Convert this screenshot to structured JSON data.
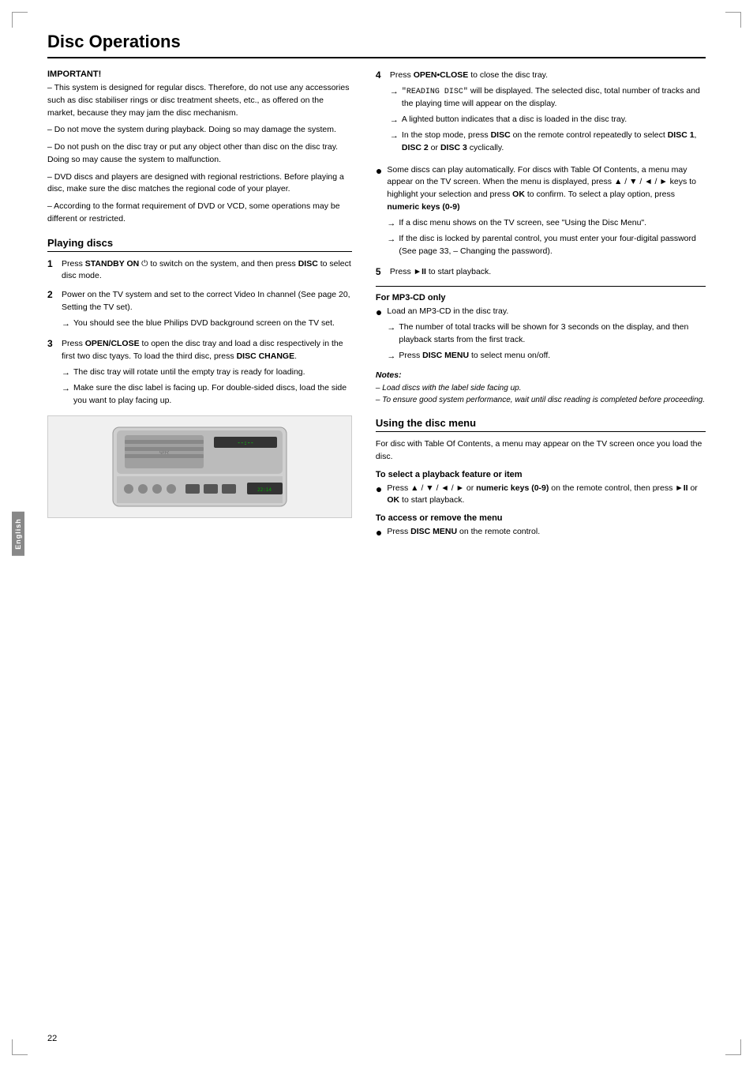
{
  "page": {
    "title": "Disc Operations",
    "page_number": "22",
    "side_tab": "English"
  },
  "important": {
    "title": "IMPORTANT!",
    "paragraphs": [
      "–  This system is designed for regular discs. Therefore, do not use any accessories such as disc stabiliser rings or disc treatment sheets, etc., as offered on the market, because they may jam the disc mechanism.",
      "–  Do not move the system during playback. Doing so may damage the system.",
      "–  Do not push on the disc tray or put any object other than disc on the disc tray. Doing so may cause the system to malfunction.",
      "–  DVD discs and players are designed with regional restrictions. Before playing a disc, make sure the disc matches the regional code of your player.",
      "–  According to the format requirement of DVD or VCD, some operations may be different or restricted."
    ]
  },
  "playing_discs": {
    "title": "Playing discs",
    "steps": [
      {
        "num": "1",
        "text": "Press ",
        "bold": "STANDBY ON",
        "icon": "⏻",
        "rest": " to switch on the system, and then press ",
        "bold2": "DISC",
        "rest2": " to select disc mode."
      },
      {
        "num": "2",
        "text": "Power on the TV system and set to the correct Video In channel (See page 20, Setting the TV set).",
        "arrow": "→ You should see the blue Philips DVD background screen on the TV set."
      },
      {
        "num": "3",
        "text_parts": [
          {
            "text": "Press ",
            "bold": "OPEN/CLOSE",
            "rest": " to open the disc tray and load a disc respectively in the first two disc tyays. To load the third disc, press ",
            "bold2": "DISC CHANGE",
            "rest2": "."
          },
          {
            "arrow": "→ The disc tray will rotate until the empty tray is ready for loading."
          },
          {
            "arrow": "→ Make sure the disc label is facing up. For double-sided discs, load the side you want to play facing up."
          }
        ]
      }
    ]
  },
  "right_col": {
    "step4": {
      "num": "4",
      "text": "Press ",
      "bold": "OPEN•CLOSE",
      "rest": " to close the disc tray.",
      "arrows": [
        "→ \"READING DISC\" will be displayed. The selected disc, total number of tracks and the playing time will appear on the display.",
        "→ A lighted button indicates that a disc is loaded in the disc tray.",
        "→ In the stop mode, press DISC on the remote control repeatedly to select DISC 1, DISC 2 or DISC 3 cyclically."
      ]
    },
    "bullet1": {
      "text": "Some discs can play automatically. For discs with Table Of Contents, a menu may appear on the TV screen. When the menu is displayed, press ▲ / ▼ / ◄ / ► keys to highlight your selection and press OK to confirm. To select a play option, press numeric keys (0-9)",
      "arrows": [
        "→ If a disc menu shows on the TV screen, see \"Using the Disc Menu\".",
        "→ If the disc is locked by parental control, you must enter your four-digital password (See page 33, – Changing the password)."
      ]
    },
    "step5": {
      "num": "5",
      "text": "Press ►II to start playback."
    },
    "mp3_section": {
      "title": "For MP3-CD only",
      "bullet": {
        "text": "Load an MP3-CD in the disc tray.",
        "arrows": [
          "→ The number of total tracks will be shown for 3 seconds on the display, and then playback starts from the first track.",
          "→ Press DISC MENU to select menu on/off."
        ]
      }
    },
    "notes": {
      "title": "Notes:",
      "items": [
        "– Load discs with the label side facing up.",
        "– To ensure good system performance, wait until disc reading is completed before proceeding."
      ]
    },
    "disc_menu": {
      "title": "Using the disc menu",
      "intro": "For disc with Table Of Contents, a menu may appear on the TV screen once you load the disc.",
      "subsections": [
        {
          "title": "To select a playback feature or item",
          "bullet": "Press ▲ / ▼ / ◄ / ► or numeric keys (0-9) on the remote control, then press ►II or OK to start playback."
        },
        {
          "title": "To access or remove the menu",
          "bullet": "Press DISC MENU on the remote control."
        }
      ]
    }
  }
}
